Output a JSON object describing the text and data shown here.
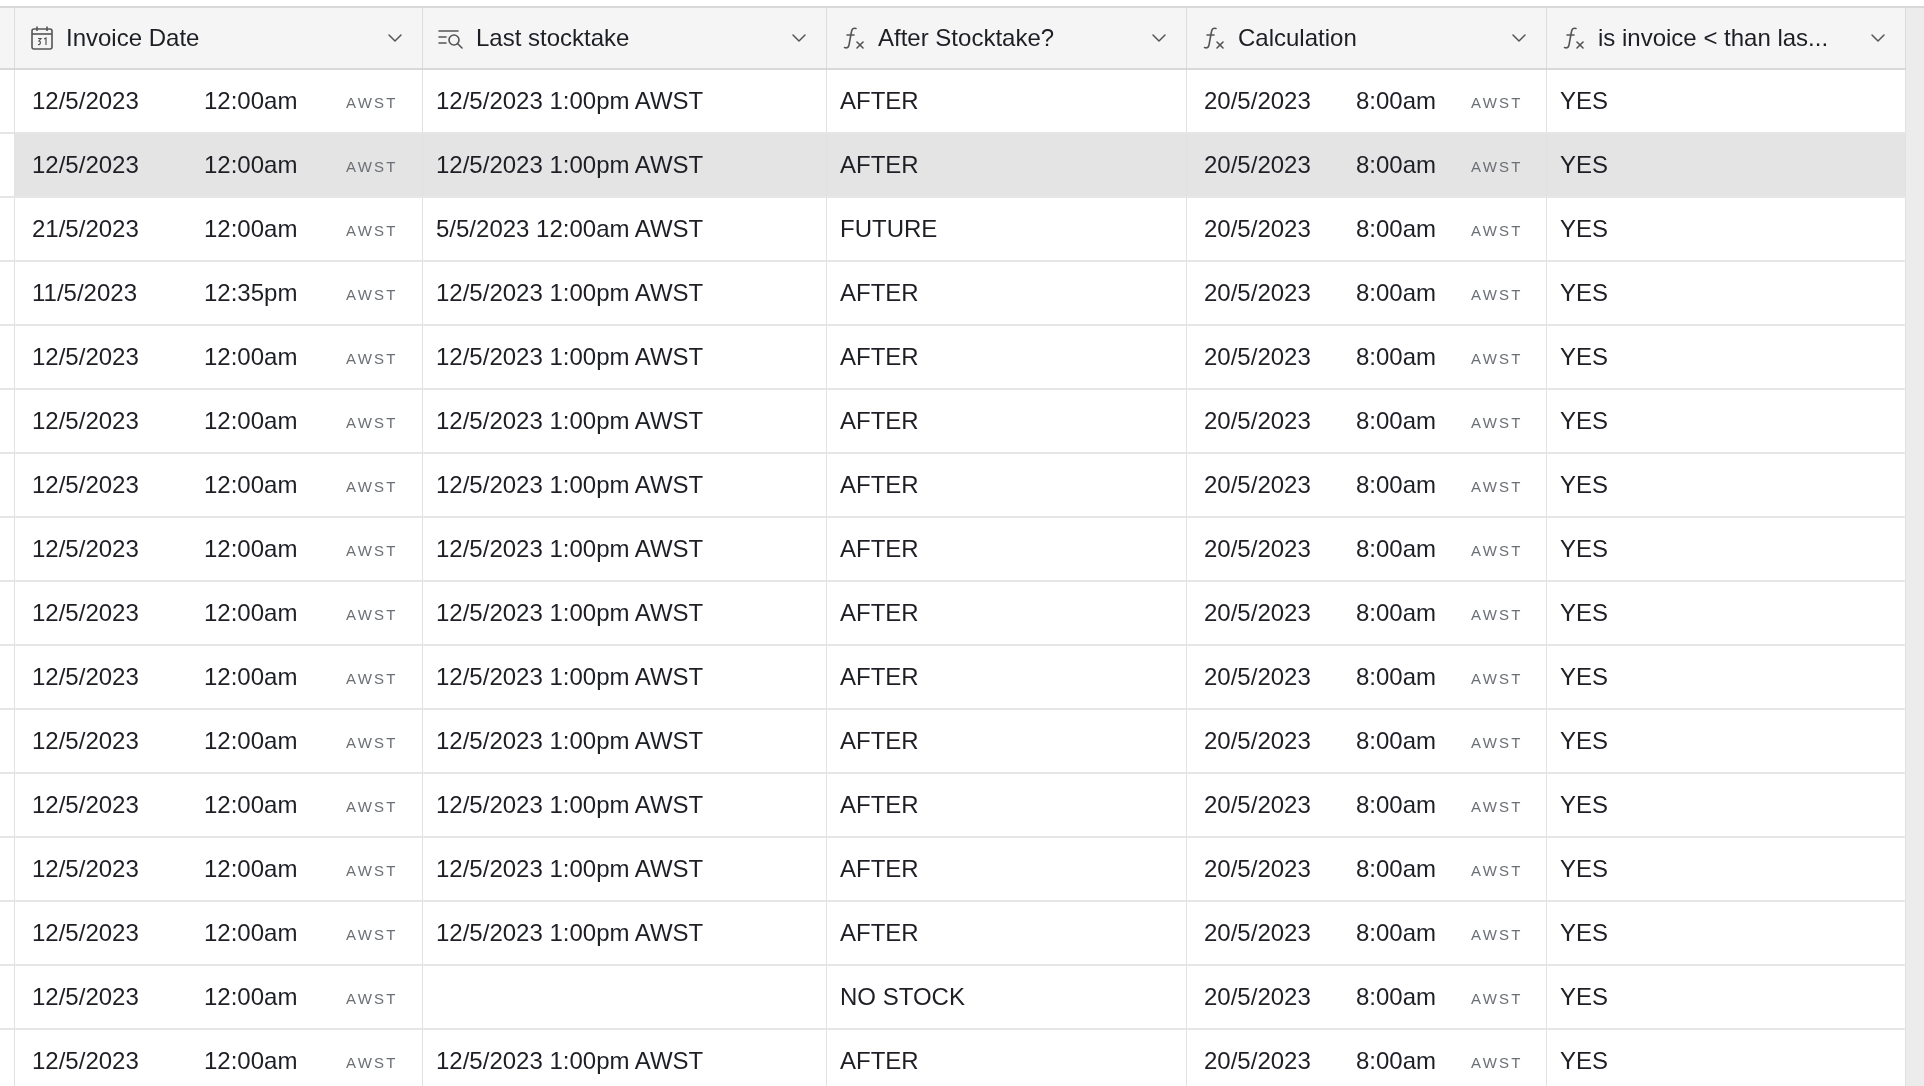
{
  "table": {
    "columns": [
      {
        "label": "Invoice Date",
        "kind": "date"
      },
      {
        "label": "Last stocktake",
        "kind": "lookup"
      },
      {
        "label": "After Stocktake?",
        "kind": "formula"
      },
      {
        "label": "Calculation",
        "kind": "formula"
      },
      {
        "label": "is invoice < than las...",
        "kind": "formula"
      }
    ],
    "rows": [
      {
        "selected": false,
        "invoice_date": {
          "date": "12/5/2023",
          "time": "12:00am",
          "tz": "AWST"
        },
        "last_stocktake": "12/5/2023 1:00pm AWST",
        "after_stocktake": "AFTER",
        "calculation": {
          "date": "20/5/2023",
          "time": "8:00am",
          "tz": "AWST"
        },
        "is_invoice": "YES"
      },
      {
        "selected": true,
        "invoice_date": {
          "date": "12/5/2023",
          "time": "12:00am",
          "tz": "AWST"
        },
        "last_stocktake": "12/5/2023 1:00pm AWST",
        "after_stocktake": "AFTER",
        "calculation": {
          "date": "20/5/2023",
          "time": "8:00am",
          "tz": "AWST"
        },
        "is_invoice": "YES"
      },
      {
        "selected": false,
        "invoice_date": {
          "date": "21/5/2023",
          "time": "12:00am",
          "tz": "AWST"
        },
        "last_stocktake": "5/5/2023 12:00am AWST",
        "after_stocktake": "FUTURE",
        "calculation": {
          "date": "20/5/2023",
          "time": "8:00am",
          "tz": "AWST"
        },
        "is_invoice": "YES"
      },
      {
        "selected": false,
        "invoice_date": {
          "date": "11/5/2023",
          "time": "12:35pm",
          "tz": "AWST"
        },
        "last_stocktake": "12/5/2023 1:00pm AWST",
        "after_stocktake": "AFTER",
        "calculation": {
          "date": "20/5/2023",
          "time": "8:00am",
          "tz": "AWST"
        },
        "is_invoice": "YES"
      },
      {
        "selected": false,
        "invoice_date": {
          "date": "12/5/2023",
          "time": "12:00am",
          "tz": "AWST"
        },
        "last_stocktake": "12/5/2023 1:00pm AWST",
        "after_stocktake": "AFTER",
        "calculation": {
          "date": "20/5/2023",
          "time": "8:00am",
          "tz": "AWST"
        },
        "is_invoice": "YES"
      },
      {
        "selected": false,
        "invoice_date": {
          "date": "12/5/2023",
          "time": "12:00am",
          "tz": "AWST"
        },
        "last_stocktake": "12/5/2023 1:00pm AWST",
        "after_stocktake": "AFTER",
        "calculation": {
          "date": "20/5/2023",
          "time": "8:00am",
          "tz": "AWST"
        },
        "is_invoice": "YES"
      },
      {
        "selected": false,
        "invoice_date": {
          "date": "12/5/2023",
          "time": "12:00am",
          "tz": "AWST"
        },
        "last_stocktake": "12/5/2023 1:00pm AWST",
        "after_stocktake": "AFTER",
        "calculation": {
          "date": "20/5/2023",
          "time": "8:00am",
          "tz": "AWST"
        },
        "is_invoice": "YES"
      },
      {
        "selected": false,
        "invoice_date": {
          "date": "12/5/2023",
          "time": "12:00am",
          "tz": "AWST"
        },
        "last_stocktake": "12/5/2023 1:00pm AWST",
        "after_stocktake": "AFTER",
        "calculation": {
          "date": "20/5/2023",
          "time": "8:00am",
          "tz": "AWST"
        },
        "is_invoice": "YES"
      },
      {
        "selected": false,
        "invoice_date": {
          "date": "12/5/2023",
          "time": "12:00am",
          "tz": "AWST"
        },
        "last_stocktake": "12/5/2023 1:00pm AWST",
        "after_stocktake": "AFTER",
        "calculation": {
          "date": "20/5/2023",
          "time": "8:00am",
          "tz": "AWST"
        },
        "is_invoice": "YES"
      },
      {
        "selected": false,
        "invoice_date": {
          "date": "12/5/2023",
          "time": "12:00am",
          "tz": "AWST"
        },
        "last_stocktake": "12/5/2023 1:00pm AWST",
        "after_stocktake": "AFTER",
        "calculation": {
          "date": "20/5/2023",
          "time": "8:00am",
          "tz": "AWST"
        },
        "is_invoice": "YES"
      },
      {
        "selected": false,
        "invoice_date": {
          "date": "12/5/2023",
          "time": "12:00am",
          "tz": "AWST"
        },
        "last_stocktake": "12/5/2023 1:00pm AWST",
        "after_stocktake": "AFTER",
        "calculation": {
          "date": "20/5/2023",
          "time": "8:00am",
          "tz": "AWST"
        },
        "is_invoice": "YES"
      },
      {
        "selected": false,
        "invoice_date": {
          "date": "12/5/2023",
          "time": "12:00am",
          "tz": "AWST"
        },
        "last_stocktake": "12/5/2023 1:00pm AWST",
        "after_stocktake": "AFTER",
        "calculation": {
          "date": "20/5/2023",
          "time": "8:00am",
          "tz": "AWST"
        },
        "is_invoice": "YES"
      },
      {
        "selected": false,
        "invoice_date": {
          "date": "12/5/2023",
          "time": "12:00am",
          "tz": "AWST"
        },
        "last_stocktake": "12/5/2023 1:00pm AWST",
        "after_stocktake": "AFTER",
        "calculation": {
          "date": "20/5/2023",
          "time": "8:00am",
          "tz": "AWST"
        },
        "is_invoice": "YES"
      },
      {
        "selected": false,
        "invoice_date": {
          "date": "12/5/2023",
          "time": "12:00am",
          "tz": "AWST"
        },
        "last_stocktake": "12/5/2023 1:00pm AWST",
        "after_stocktake": "AFTER",
        "calculation": {
          "date": "20/5/2023",
          "time": "8:00am",
          "tz": "AWST"
        },
        "is_invoice": "YES"
      },
      {
        "selected": false,
        "invoice_date": {
          "date": "12/5/2023",
          "time": "12:00am",
          "tz": "AWST"
        },
        "after_stocktake": "NO STOCK",
        "calculation": {
          "date": "20/5/2023",
          "time": "8:00am",
          "tz": "AWST"
        },
        "is_invoice": "YES"
      },
      {
        "selected": false,
        "invoice_date": {
          "date": "12/5/2023",
          "time": "12:00am",
          "tz": "AWST"
        },
        "last_stocktake": "12/5/2023 1:00pm AWST",
        "after_stocktake": "AFTER",
        "calculation": {
          "date": "20/5/2023",
          "time": "8:00am",
          "tz": "AWST"
        },
        "is_invoice": "YES"
      }
    ]
  }
}
